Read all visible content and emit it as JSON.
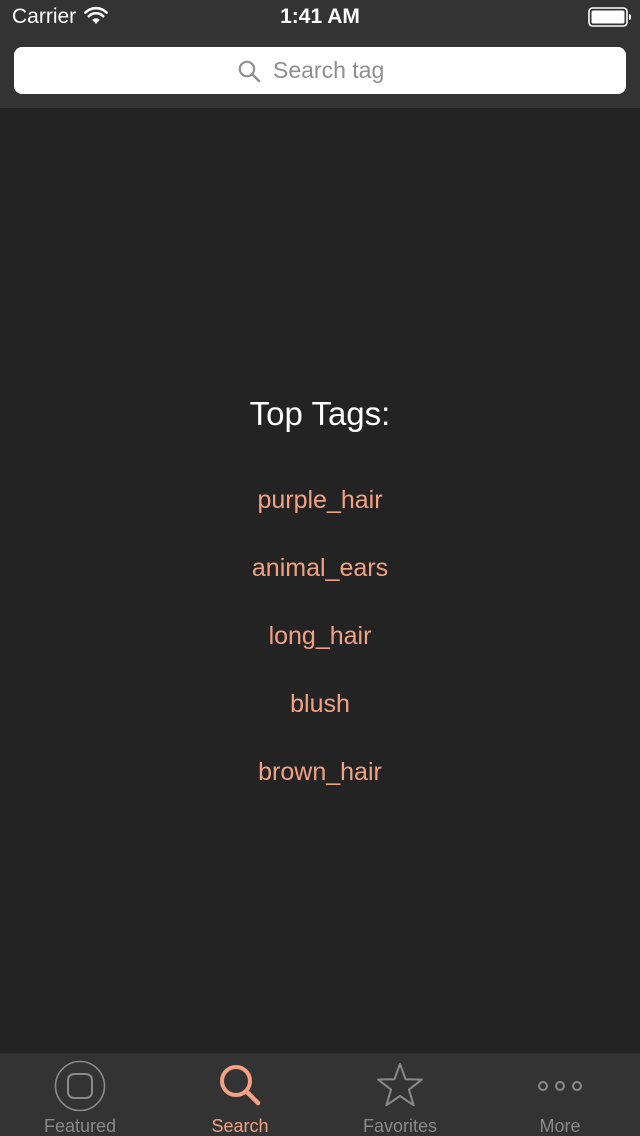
{
  "status_bar": {
    "carrier": "Carrier",
    "time": "1:41 AM",
    "wifi_icon": "wifi-icon",
    "battery_icon": "battery-icon"
  },
  "search": {
    "placeholder": "Search tag",
    "value": "",
    "icon": "search-icon"
  },
  "main": {
    "title": "Top Tags:",
    "tags": [
      {
        "label": "purple_hair"
      },
      {
        "label": "animal_ears"
      },
      {
        "label": "long_hair"
      },
      {
        "label": "blush"
      },
      {
        "label": "brown_hair"
      }
    ]
  },
  "tab_bar": {
    "tabs": [
      {
        "label": "Featured",
        "icon": "featured-icon",
        "active": false
      },
      {
        "label": "Search",
        "icon": "search-tab-icon",
        "active": true
      },
      {
        "label": "Favorites",
        "icon": "star-icon",
        "active": false
      },
      {
        "label": "More",
        "icon": "more-icon",
        "active": false
      }
    ]
  },
  "colors": {
    "background": "#232323",
    "header": "#333333",
    "accent": "#f2a283",
    "inactive": "#8a8a8a",
    "text": "#ffffff"
  }
}
